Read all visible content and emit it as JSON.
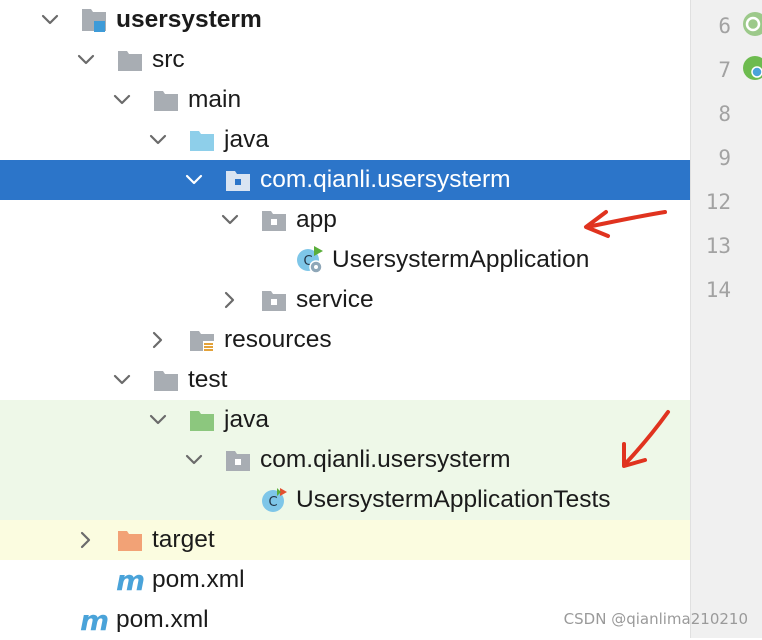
{
  "tree": [
    {
      "label": "usersysterm",
      "indent": 0,
      "state": "expanded",
      "icon": "module-folder-icon",
      "style": "plain",
      "bold": true
    },
    {
      "label": "src",
      "indent": 1,
      "state": "expanded",
      "icon": "folder-icon",
      "style": "plain"
    },
    {
      "label": "main",
      "indent": 2,
      "state": "expanded",
      "icon": "folder-icon",
      "style": "plain"
    },
    {
      "label": "java",
      "indent": 3,
      "state": "expanded",
      "icon": "source-folder-icon",
      "style": "plain"
    },
    {
      "label": "com.qianli.usersysterm",
      "indent": 4,
      "state": "expanded",
      "icon": "package-icon",
      "style": "selected"
    },
    {
      "label": "app",
      "indent": 5,
      "state": "expanded",
      "icon": "package-icon",
      "style": "plain"
    },
    {
      "label": "UsersystermApplication",
      "indent": 6,
      "state": "none",
      "icon": "spring-boot-class-icon",
      "style": "plain"
    },
    {
      "label": "service",
      "indent": 5,
      "state": "collapsed",
      "icon": "package-icon",
      "style": "plain"
    },
    {
      "label": "resources",
      "indent": 3,
      "state": "collapsed",
      "icon": "resources-folder-icon",
      "style": "plain"
    },
    {
      "label": "test",
      "indent": 2,
      "state": "expanded",
      "icon": "folder-icon",
      "style": "plain"
    },
    {
      "label": "java",
      "indent": 3,
      "state": "expanded",
      "icon": "test-folder-icon",
      "style": "test"
    },
    {
      "label": "com.qianli.usersysterm",
      "indent": 4,
      "state": "expanded",
      "icon": "package-icon",
      "style": "test"
    },
    {
      "label": "UsersystermApplicationTests",
      "indent": 5,
      "state": "none",
      "icon": "test-class-icon",
      "style": "test"
    },
    {
      "label": "target",
      "indent": 1,
      "state": "collapsed",
      "icon": "excluded-folder-icon",
      "style": "excluded"
    },
    {
      "label": "pom.xml",
      "indent": 1,
      "state": "none",
      "icon": "maven-icon",
      "style": "plain"
    },
    {
      "label": "pom.xml",
      "indent": 0,
      "state": "none",
      "icon": "maven-icon",
      "style": "plain"
    }
  ],
  "gutter": {
    "lines": [
      "6",
      "7",
      "8",
      "9",
      "12",
      "13",
      "14"
    ]
  },
  "colors": {
    "selection": "#2c75c9",
    "test_bg": "#eef8e8",
    "excluded_bg": "#fbfce0",
    "arrow": "#e0331f"
  },
  "watermark": "CSDN @qianlima210210"
}
